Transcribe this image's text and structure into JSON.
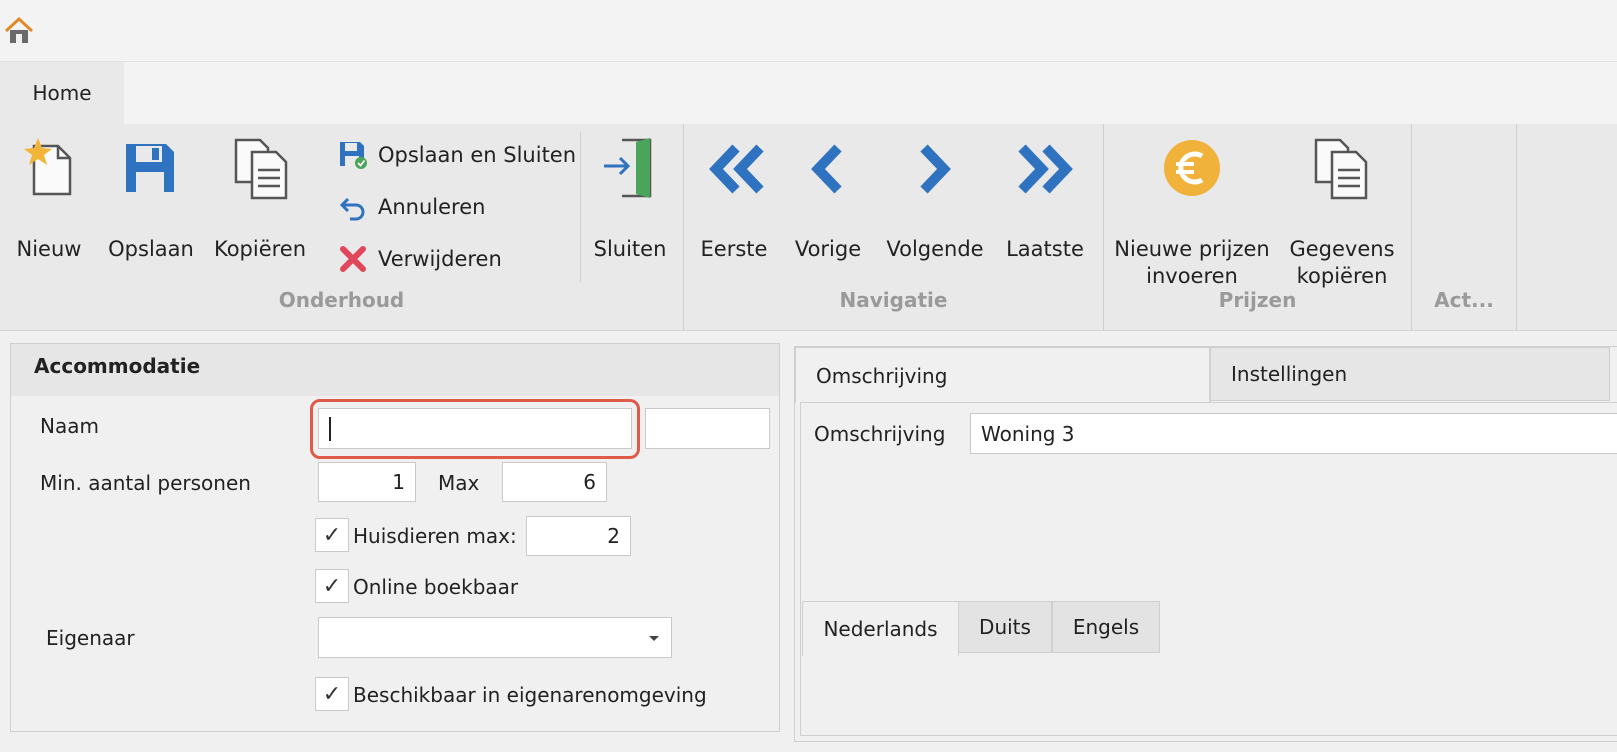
{
  "tabs": {
    "home": "Home"
  },
  "ribbon": {
    "onderhoud": {
      "group_label": "Onderhoud",
      "nieuw": "Nieuw",
      "opslaan": "Opslaan",
      "kopieren": "Kopiëren",
      "opslaan_sluiten": "Opslaan en Sluiten",
      "annuleren": "Annuleren",
      "verwijderen": "Verwijderen",
      "sluiten": "Sluiten"
    },
    "navigatie": {
      "group_label": "Navigatie",
      "eerste": "Eerste",
      "vorige": "Vorige",
      "volgende": "Volgende",
      "laatste": "Laatste"
    },
    "prijzen": {
      "group_label": "Prijzen",
      "nieuwe_prijzen_1": "Nieuwe prijzen",
      "nieuwe_prijzen_2": "invoeren",
      "gegevens_1": "Gegevens",
      "gegevens_2": "kopiëren"
    },
    "acties": {
      "group_label": "Act..."
    }
  },
  "form": {
    "title": "Accommodatie",
    "naam_label": "Naam",
    "naam_value": "",
    "naam_extra_value": "",
    "min_label": "Min. aantal personen",
    "min_value": "1",
    "max_label": "Max",
    "max_value": "6",
    "huisdieren_label": "Huisdieren max:",
    "huisdieren_checked": true,
    "huisdieren_value": "2",
    "online_label": "Online boekbaar",
    "online_checked": true,
    "eigenaar_label": "Eigenaar",
    "eigenaar_value": "",
    "beschikbaar_label": "Beschikbaar in eigenarenomgeving",
    "beschikbaar_checked": true
  },
  "details": {
    "tab_omschrijving": "Omschrijving",
    "tab_instellingen": "Instellingen",
    "omschrijving_label": "Omschrijving",
    "omschrijving_value": "Woning 3",
    "lang_nl": "Nederlands",
    "lang_de": "Duits",
    "lang_en": "Engels"
  },
  "colors": {
    "accent_blue": "#2f73c0",
    "euro_orange": "#f0b23a",
    "delete_red": "#e0475a",
    "focus_ring": "#e05a4a"
  }
}
